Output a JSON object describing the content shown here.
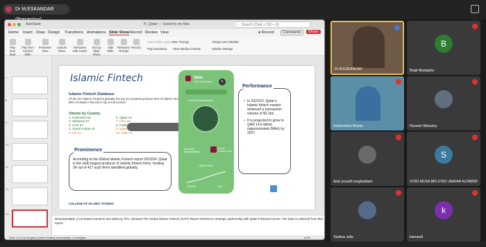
{
  "meeting": {
    "presenter_label": "Dr M.ESKANDAR (Presenting)"
  },
  "ppt": {
    "title": "IF_Qatar — Saved to my Mac",
    "autosave": "AutoSave",
    "search_placeholder": "Search (Cmd + Ctrl + U)",
    "tabs": [
      "Home",
      "Insert",
      "Draw",
      "Design",
      "Transitions",
      "Animations",
      "Slide Show",
      "Record",
      "Review",
      "View"
    ],
    "active_tab": "Slide Show",
    "record_label": "Record",
    "comments_label": "Comments",
    "share_label": "Share",
    "ribbon_buttons": [
      "Play from Start",
      "Play from Current Slide",
      "Presenter View",
      "Custom Show",
      "Rehearse with Coach",
      "Set Up Slide Show",
      "Hide Slide",
      "Rehearse Timings",
      "Record"
    ],
    "ribbon_checks": [
      "Keep Slides Updated",
      "Use Timings",
      "Play Narrations",
      "Show Media Controls",
      "Always Use Subtitles",
      "Subtitle Settings"
    ],
    "thumb_numbers": [
      "7",
      "8",
      "9",
      "10",
      "11",
      "12",
      "13"
    ],
    "notes": "DinarStandard, a US-based research and advisory firm, released The Global Islamic Fintech (GIFT) Report 2023/24 in strategic partnership with Qatar Financial Center. The data is collected from that report.",
    "status": "Slide 13 of 16    English (United States)    Accessibility: Investigate",
    "zoom": "142%"
  },
  "slide": {
    "title": "Islamic Fintech",
    "db_title": "Islamic Fintech Database",
    "db_desc": "Of the 417 Islamic Fintechs globally, the top 10 countries produce 81% of Islamic Fintechs, with 69% of Islamic Fintechs in top 5 sub-sectors",
    "volume_title": "Volume by Country",
    "ranks_left": [
      "1. Indonesia 65",
      "2. Malaysia 57",
      "3. UAE 47",
      "4. Saudi Arabia 43",
      "5. UK 42"
    ],
    "ranks_right": [
      "6. Qatar 24",
      "7. USA 20",
      "8. Pakistan 15",
      "9. Egypt 11",
      "10. India 11"
    ],
    "prominence_title": "Prominence",
    "prominence_text": "According to the Global Islamic Fintech report 2023/24, Qatar is the sixth largest producer of Islamic fintech firms, hosting 24 out of 417 such firms identified globally.",
    "performance_title": "Performance",
    "performance_points": [
      "In 2022/23, Qatar's Islamic fintech market achieved a transaction volume of $2.1bn.",
      "It is projected to grow to QAR 14.6 billion (approximately $4bn) by 2027."
    ],
    "card_country": "Qatar",
    "card_sub": "GIFT Index Rank",
    "card_rank": "6",
    "card_hub": "Hub Self Assessment",
    "card_label1": "Exemplar Representative",
    "card_label2": "QATAR FINTECH HUB",
    "card_market": "Market Size",
    "card_y1": "2022/23",
    "card_y2": "2027",
    "footer": "COLLEGE OF ISLAMIC STUDIES"
  },
  "participants": [
    {
      "name": "Dr M.ESKANDAR",
      "initial": "",
      "color": "#6f5a48"
    },
    {
      "name": "Baqir Mustapha",
      "initial": "B",
      "color": "#2f7d32"
    },
    {
      "name": "Khairunnisa Musari",
      "initial": "",
      "color": "#5b8fa7"
    },
    {
      "name": "Hossein Meisamy",
      "initial": "",
      "color": "#607080"
    },
    {
      "name": "Amir yousefi moghaddam",
      "initial": "",
      "color": "#6a6a6a"
    },
    {
      "name": "SYED MUSA BIN SYED JAAFAR ALHABSHI",
      "initial": "S",
      "color": "#3a7ba0"
    },
    {
      "name": "Taslima Julia",
      "initial": "",
      "color": "#556b8a"
    },
    {
      "name": "kamandi",
      "initial": "k",
      "color": "#7b2fb0"
    }
  ]
}
